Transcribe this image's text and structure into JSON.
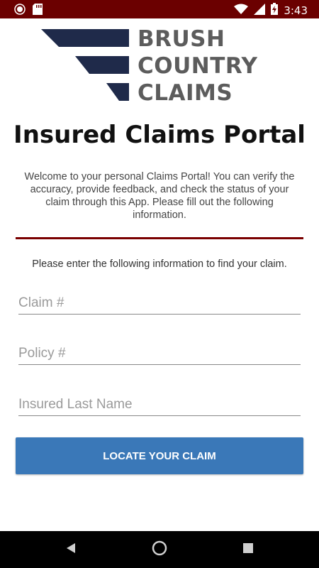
{
  "status_bar": {
    "time": "3:43",
    "icons": [
      "record-icon",
      "sd-card-icon",
      "wifi-icon",
      "signal-icon",
      "battery-charging-icon"
    ]
  },
  "logo": {
    "lines": [
      "BRUSH",
      "COUNTRY",
      "CLAIMS"
    ],
    "color_bars": "#1f2a4a",
    "color_text": "#5c5c5c"
  },
  "title": "Insured Claims Portal",
  "welcome_text": "Welcome to your personal Claims Portal! You can verify the accuracy, provide feedback, and check the status of your claim through this App. Please fill out the following information.",
  "instruction": "Please enter the following information to find your claim.",
  "form": {
    "claim_placeholder": "Claim #",
    "policy_placeholder": "Policy #",
    "last_name_placeholder": "Insured Last Name",
    "submit_label": "LOCATE YOUR CLAIM"
  },
  "colors": {
    "status_bar": "#6b0000",
    "divider": "#7a0000",
    "button": "#3a78b8"
  },
  "nav_bar": {
    "icons": [
      "back-icon",
      "home-icon",
      "recents-icon"
    ]
  }
}
